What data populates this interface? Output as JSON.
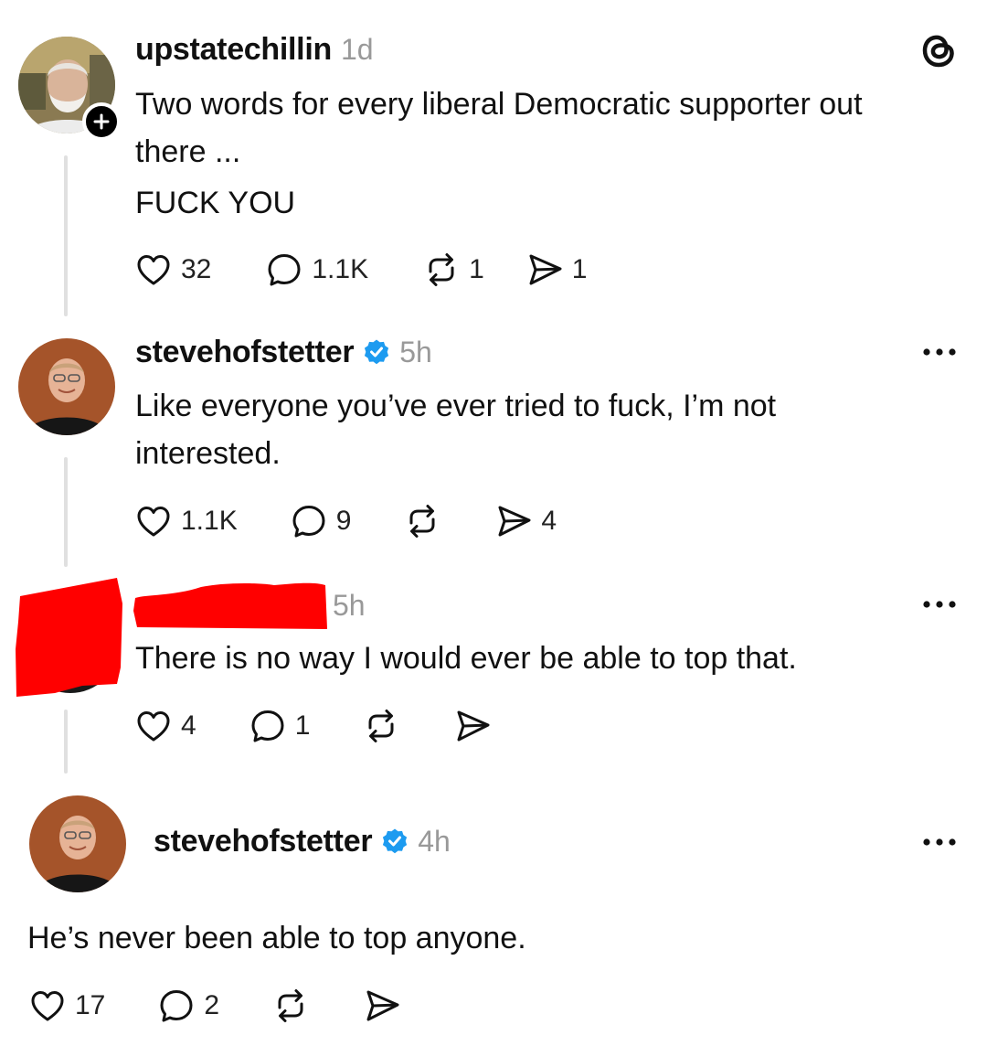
{
  "posts": [
    {
      "username": "upstatechillin",
      "time": "1d",
      "verified": false,
      "text_lines": [
        "Two words for every liberal Democratic supporter out",
        "there ...",
        "FUCK YOU"
      ],
      "likes": "32",
      "replies": "1.1K",
      "reposts": "1",
      "shares": "1"
    },
    {
      "username": "stevehofstetter",
      "time": "5h",
      "verified": true,
      "text_lines": [
        "Like everyone you’ve ever tried to fuck, I’m not",
        "interested."
      ],
      "likes": "1.1K",
      "replies": "9",
      "reposts": "",
      "shares": "4"
    },
    {
      "username": "",
      "time": "5h",
      "verified": false,
      "text_lines": [
        "There is no way I would ever be able to top that."
      ],
      "likes": "4",
      "replies": "1",
      "reposts": "",
      "shares": ""
    },
    {
      "username": "stevehofstetter",
      "time": "4h",
      "verified": true,
      "text_lines": [
        "He’s never been able to top anyone."
      ],
      "likes": "17",
      "replies": "2",
      "reposts": "",
      "shares": ""
    }
  ],
  "colors": {
    "text": "#111111",
    "muted": "#999999",
    "verified": "#1d9bf0",
    "thread_line": "#e0e0e0",
    "redaction": "#ff0000"
  },
  "icons": {
    "app": "threads-logo-icon",
    "like": "heart-icon",
    "reply": "comment-bubble-icon",
    "repost": "repost-icon",
    "share": "send-icon",
    "more": "more-options-icon",
    "verified": "verified-badge-icon",
    "follow": "plus-icon"
  }
}
